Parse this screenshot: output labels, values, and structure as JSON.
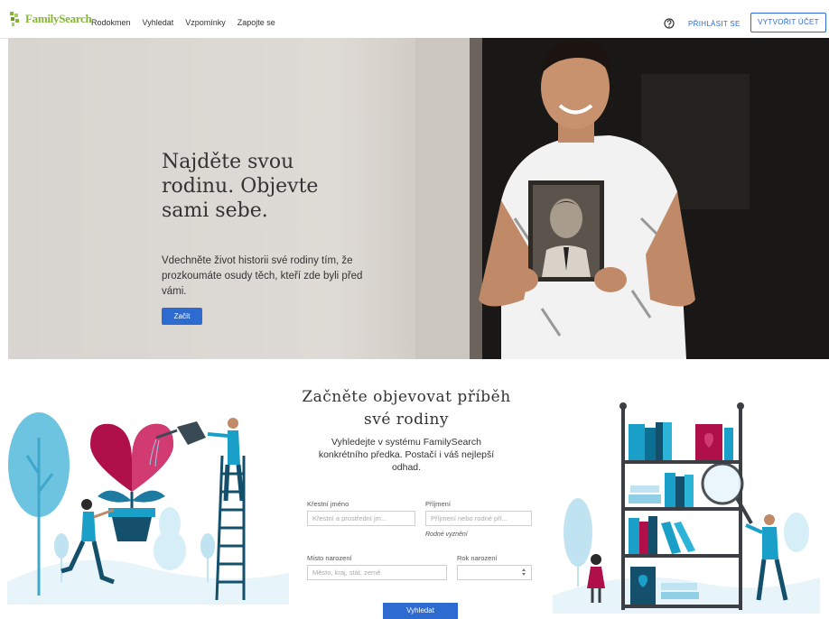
{
  "header": {
    "logo_text": "FamilySearch",
    "nav": [
      "Rodokmen",
      "Vyhledat",
      "Vzpomínky",
      "Zapojte se"
    ],
    "help_icon": "question-circle-icon",
    "signin_label": "PŘIHLÁSIT SE",
    "create_label": "VYTVOŘIT ÚČET"
  },
  "hero": {
    "title": "Najděte svou rodinu. Objevte sami sebe.",
    "subtitle": "Vdechněte život historii své rodiny tím, že prozkoumáte osudy těch, kteří zde byli před vámi.",
    "start_label": "Začít"
  },
  "search": {
    "title": "Začněte objevovat příběh své rodiny",
    "subtitle": "Vyhledejte v systému FamilySearch konkrétního předka. Postačí i váš nejlepší odhad.",
    "first_name_label": "Křestní jméno",
    "first_name_placeholder": "Křestní a prostřední jm...",
    "last_name_label": "Příjmení",
    "last_name_placeholder": "Příjmení nebo rodné pří...",
    "alt_link": "Rodné vyznění",
    "birthplace_label": "Místo narození",
    "birthplace_placeholder": "Město, kraj, stát, země",
    "birthyear_label": "Rok narození",
    "birthyear_value": "",
    "search_label": "Vyhledat"
  },
  "colors": {
    "brand_green": "#85b636",
    "accent_blue": "#2d6bd1",
    "illustration_blue": "#1aa0c8",
    "illustration_red": "#b0104a"
  }
}
